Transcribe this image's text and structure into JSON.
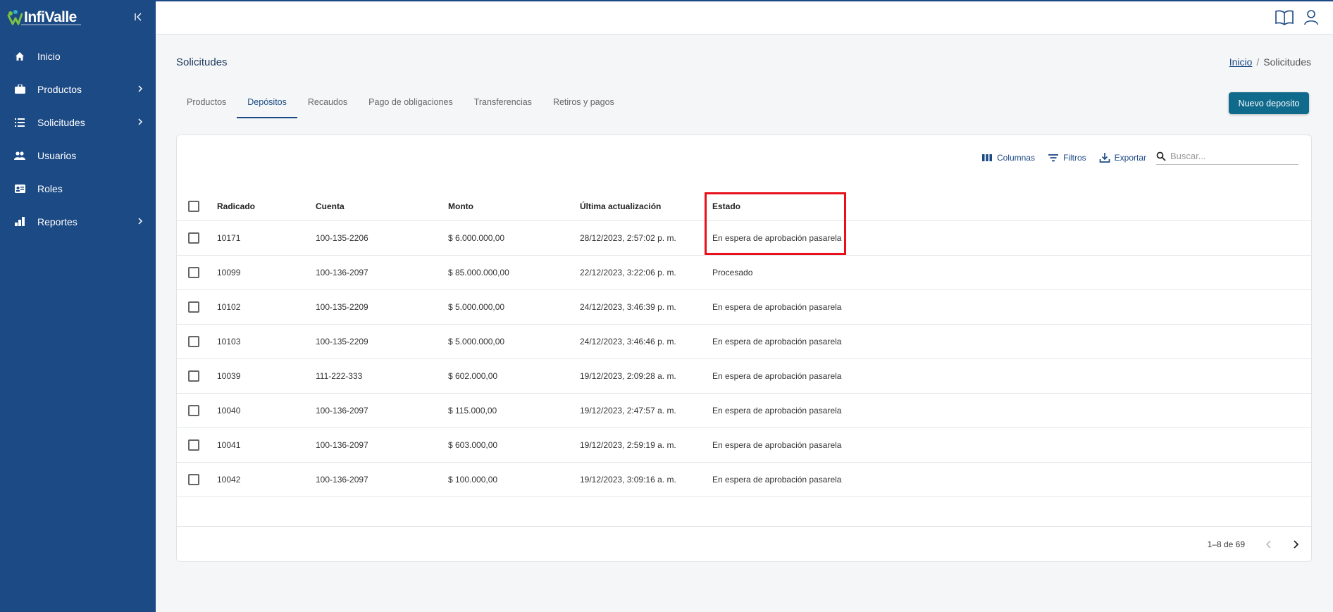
{
  "brand": {
    "logo_text": "InfiValle"
  },
  "sidebar": {
    "items": [
      {
        "label": "Inicio",
        "icon": "home-icon",
        "has_children": false
      },
      {
        "label": "Productos",
        "icon": "briefcase-icon",
        "has_children": true
      },
      {
        "label": "Solicitudes",
        "icon": "list-icon",
        "has_children": true
      },
      {
        "label": "Usuarios",
        "icon": "users-icon",
        "has_children": false
      },
      {
        "label": "Roles",
        "icon": "id-card-icon",
        "has_children": false
      },
      {
        "label": "Reportes",
        "icon": "bar-chart-icon",
        "has_children": true
      }
    ]
  },
  "header": {
    "title": "Solicitudes"
  },
  "breadcrumb": {
    "home": "Inicio",
    "sep": "/",
    "current": "Solicitudes"
  },
  "tabs": [
    {
      "label": "Productos",
      "active": false
    },
    {
      "label": "Depósitos",
      "active": true
    },
    {
      "label": "Recaudos",
      "active": false
    },
    {
      "label": "Pago de obligaciones",
      "active": false
    },
    {
      "label": "Transferencias",
      "active": false
    },
    {
      "label": "Retiros y pagos",
      "active": false
    }
  ],
  "actions": {
    "new_label": "Nuevo deposito"
  },
  "toolbar": {
    "columns_label": "Columnas",
    "filters_label": "Filtros",
    "export_label": "Exportar",
    "search_placeholder": "Buscar..."
  },
  "table": {
    "columns": [
      "Radicado",
      "Cuenta",
      "Monto",
      "Última actualización",
      "Estado"
    ],
    "rows": [
      [
        "10171",
        "100-135-2206",
        "$ 6.000.000,00",
        "28/12/2023, 2:57:02 p. m.",
        "En espera de aprobación pasarela"
      ],
      [
        "10099",
        "100-136-2097",
        "$ 85.000.000,00",
        "22/12/2023, 3:22:06 p. m.",
        "Procesado"
      ],
      [
        "10102",
        "100-135-2209",
        "$ 5.000.000,00",
        "24/12/2023, 3:46:39 p. m.",
        "En espera de aprobación pasarela"
      ],
      [
        "10103",
        "100-135-2209",
        "$ 5.000.000,00",
        "24/12/2023, 3:46:46 p. m.",
        "En espera de aprobación pasarela"
      ],
      [
        "10039",
        "111-222-333",
        "$ 602.000,00",
        "19/12/2023, 2:09:28 a. m.",
        "En espera de aprobación pasarela"
      ],
      [
        "10040",
        "100-136-2097",
        "$ 115.000,00",
        "19/12/2023, 2:47:57 a. m.",
        "En espera de aprobación pasarela"
      ],
      [
        "10041",
        "100-136-2097",
        "$ 603.000,00",
        "19/12/2023, 2:59:19 a. m.",
        "En espera de aprobación pasarela"
      ],
      [
        "10042",
        "100-136-2097",
        "$ 100.000,00",
        "19/12/2023, 3:09:16 a. m.",
        "En espera de aprobación pasarela"
      ]
    ]
  },
  "pagination": {
    "range": "1–8 de 69"
  },
  "colors": {
    "sidebar": "#1c4a85",
    "primary_button": "#0f6a8c",
    "highlight": "#e8101a"
  }
}
